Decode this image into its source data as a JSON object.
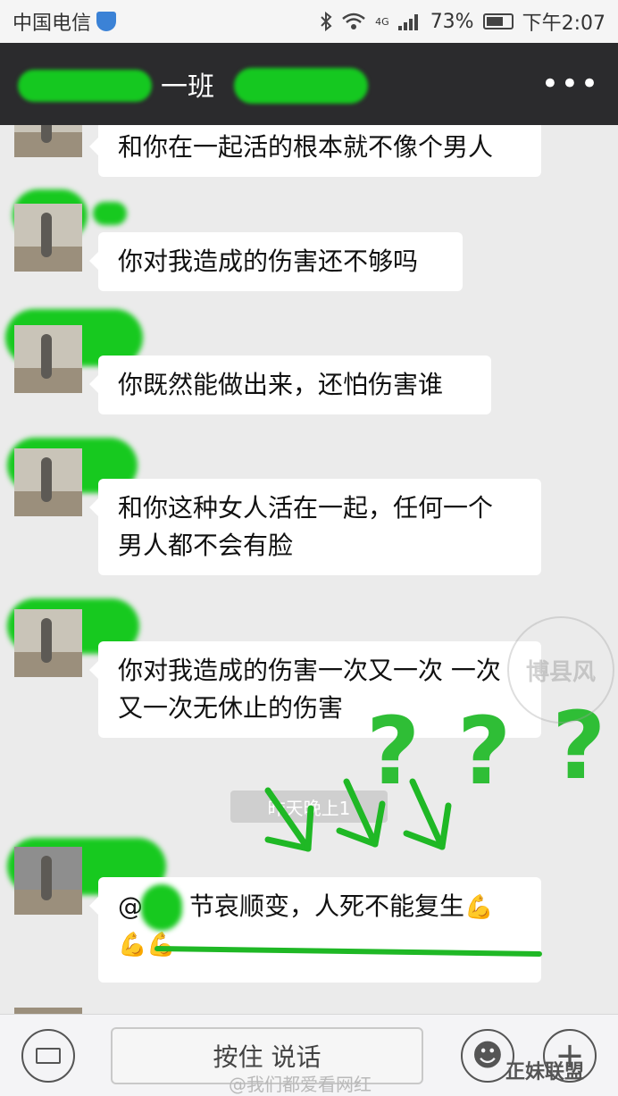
{
  "status_bar": {
    "carrier": "中国电信",
    "battery": "73%",
    "network": "4G",
    "time": "下午2:07"
  },
  "header": {
    "title": "一班",
    "more": "•••"
  },
  "messages": [
    {
      "text": "和你在一起活的根本就不像个男人"
    },
    {
      "text": "你对我造成的伤害还不够吗"
    },
    {
      "text": "你既然能做出来，还怕伤害谁"
    },
    {
      "line1": "和你这种女人活在一起，任何一个",
      "line2": "男人都不会有脸"
    },
    {
      "line1": "你对我造成的伤害一次又一次 一次",
      "line2": "又一次无休止的伤害"
    },
    {
      "at": "@",
      "line1": "节哀顺变，人死不能复生",
      "emoji": "💪",
      "emoji2": "💪💪"
    }
  ],
  "time_label": "昨天晚上1",
  "annotations": {
    "question_mark": "?"
  },
  "input_bar": {
    "talk_label": "按住 说话",
    "emoji_icon": "☻",
    "plus_icon": "+"
  },
  "watermarks": {
    "weibo": "@我们都爱看网红",
    "brand": "正妹联盟",
    "seal": "博县风"
  },
  "colors": {
    "title_bar": "#2b2b2d",
    "chat_bg": "#ebebeb",
    "highlight_green": "#15c820"
  }
}
